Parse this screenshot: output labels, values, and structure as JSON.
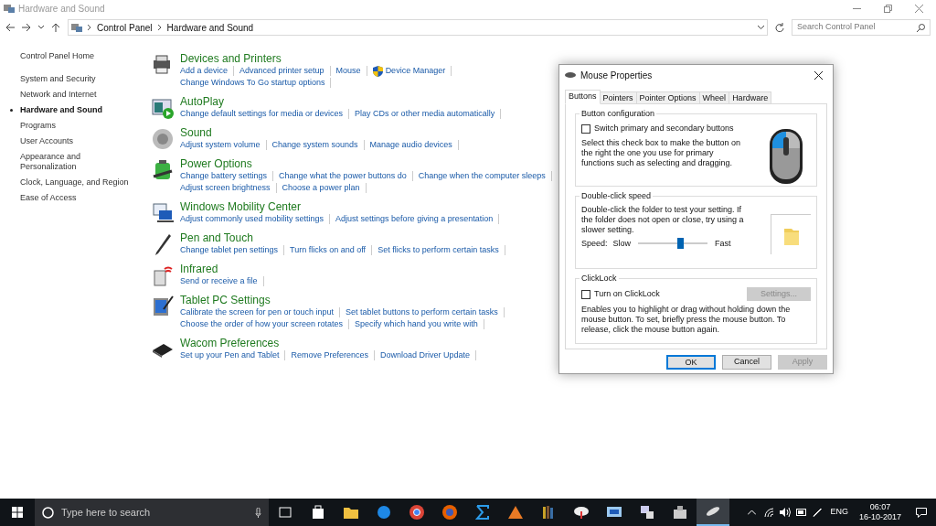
{
  "window": {
    "title": "Hardware and Sound"
  },
  "address_bar": {
    "path": [
      "Control Panel",
      "Hardware and Sound"
    ],
    "search_placeholder": "Search Control Panel"
  },
  "sidebar": {
    "home": "Control Panel Home",
    "items": [
      {
        "label": "System and Security",
        "selected": false
      },
      {
        "label": "Network and Internet",
        "selected": false
      },
      {
        "label": "Hardware and Sound",
        "selected": true
      },
      {
        "label": "Programs",
        "selected": false
      },
      {
        "label": "User Accounts",
        "selected": false
      },
      {
        "label": "Appearance and Personalization",
        "selected": false
      },
      {
        "label": "Clock, Language, and Region",
        "selected": false
      },
      {
        "label": "Ease of Access",
        "selected": false
      }
    ]
  },
  "sections": [
    {
      "title": "Devices and Printers",
      "rows": [
        [
          {
            "text": "Add a device"
          },
          {
            "text": "Advanced printer setup"
          },
          {
            "text": "Mouse"
          },
          {
            "text": "Device Manager",
            "shield": true
          }
        ],
        [
          {
            "text": "Change Windows To Go startup options"
          }
        ]
      ]
    },
    {
      "title": "AutoPlay",
      "rows": [
        [
          {
            "text": "Change default settings for media or devices"
          },
          {
            "text": "Play CDs or other media automatically"
          }
        ]
      ]
    },
    {
      "title": "Sound",
      "rows": [
        [
          {
            "text": "Adjust system volume"
          },
          {
            "text": "Change system sounds"
          },
          {
            "text": "Manage audio devices"
          }
        ]
      ]
    },
    {
      "title": "Power Options",
      "rows": [
        [
          {
            "text": "Change battery settings"
          },
          {
            "text": "Change what the power buttons do"
          },
          {
            "text": "Change when the computer sleeps"
          }
        ],
        [
          {
            "text": "Adjust screen brightness"
          },
          {
            "text": "Choose a power plan"
          }
        ]
      ]
    },
    {
      "title": "Windows Mobility Center",
      "rows": [
        [
          {
            "text": "Adjust commonly used mobility settings"
          },
          {
            "text": "Adjust settings before giving a presentation"
          }
        ]
      ]
    },
    {
      "title": "Pen and Touch",
      "rows": [
        [
          {
            "text": "Change tablet pen settings"
          },
          {
            "text": "Turn flicks on and off"
          },
          {
            "text": "Set flicks to perform certain tasks"
          }
        ]
      ]
    },
    {
      "title": "Infrared",
      "rows": [
        [
          {
            "text": "Send or receive a file"
          }
        ]
      ]
    },
    {
      "title": "Tablet PC Settings",
      "rows": [
        [
          {
            "text": "Calibrate the screen for pen or touch input"
          },
          {
            "text": "Set tablet buttons to perform certain tasks"
          }
        ],
        [
          {
            "text": "Choose the order of how your screen rotates"
          },
          {
            "text": "Specify which hand you write with"
          }
        ]
      ]
    },
    {
      "title": "Wacom Preferences",
      "rows": [
        [
          {
            "text": "Set up your Pen and Tablet"
          },
          {
            "text": "Remove Preferences"
          },
          {
            "text": "Download Driver Update"
          }
        ]
      ]
    }
  ],
  "dialog": {
    "title": "Mouse Properties",
    "tabs": [
      {
        "label": "Buttons",
        "selected": true
      },
      {
        "label": "Pointers",
        "selected": false
      },
      {
        "label": "Pointer Options",
        "selected": false
      },
      {
        "label": "Wheel",
        "selected": false
      },
      {
        "label": "Hardware",
        "selected": false
      }
    ],
    "button_configuration": {
      "legend": "Button configuration",
      "checkbox": {
        "label": "Switch primary and secondary buttons",
        "checked": false
      },
      "description": "Select this check box to make the button on the right the one you use for primary functions such as selecting and dragging."
    },
    "double_click": {
      "legend": "Double-click speed",
      "description": "Double-click the folder to test your setting. If the folder does not open or close, try using a slower setting.",
      "speed_label": "Speed:",
      "slow": "Slow",
      "fast": "Fast",
      "level": 0.6
    },
    "clicklock": {
      "legend": "ClickLock",
      "checkbox": {
        "label": "Turn on ClickLock",
        "checked": false
      },
      "settings_button": {
        "label": "Settings...",
        "disabled": true
      },
      "description": "Enables you to highlight or drag without holding down the mouse button. To set, briefly press the mouse button. To release, click the mouse button again."
    },
    "buttons": [
      {
        "label": "OK",
        "disabled": false
      },
      {
        "label": "Cancel",
        "disabled": false
      },
      {
        "label": "Apply",
        "disabled": true
      }
    ]
  },
  "taskbar": {
    "search_placeholder": "Type here to search",
    "language": "ENG",
    "time": "06:07",
    "date": "16-10-2017"
  }
}
